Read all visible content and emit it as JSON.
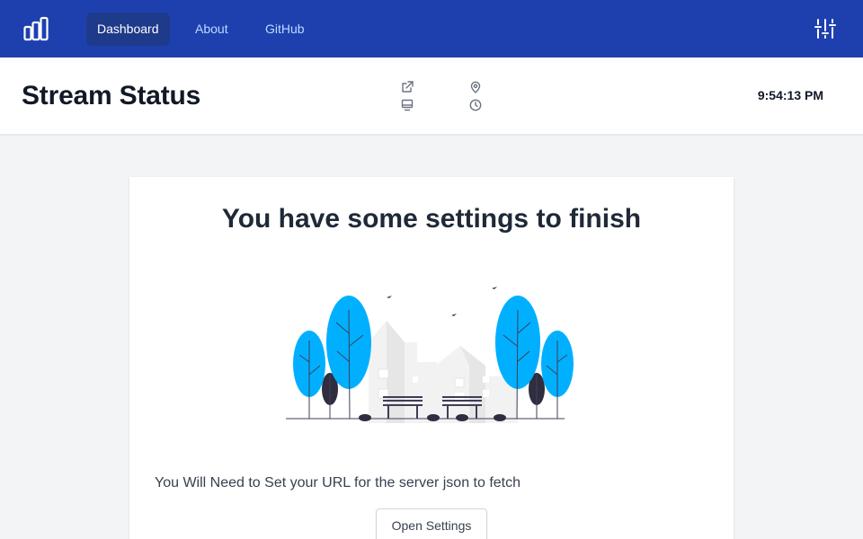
{
  "nav": {
    "logo_icon": "bar-chart-logo-icon",
    "links": [
      {
        "label": "Dashboard",
        "active": true
      },
      {
        "label": "About",
        "active": false
      },
      {
        "label": "GitHub",
        "active": false
      }
    ],
    "settings_icon": "sliders-icon"
  },
  "header": {
    "title": "Stream Status",
    "meta_icons": [
      "external-link-icon",
      "monitor-icon",
      "map-pin-icon",
      "clock-icon"
    ],
    "time": "9:54:13 PM"
  },
  "card": {
    "title": "You have some settings to finish",
    "illustration": "park-houses-trees-illustration",
    "message": "You Will Need to Set your URL for the server json to fetch",
    "button_label": "Open Settings"
  },
  "colors": {
    "navbar": "#1e40af",
    "nav_active": "#1e3a8a",
    "tree_blue": "#00b0ff",
    "dark_tree": "#2f2e41",
    "page_bg": "#f3f4f6"
  }
}
